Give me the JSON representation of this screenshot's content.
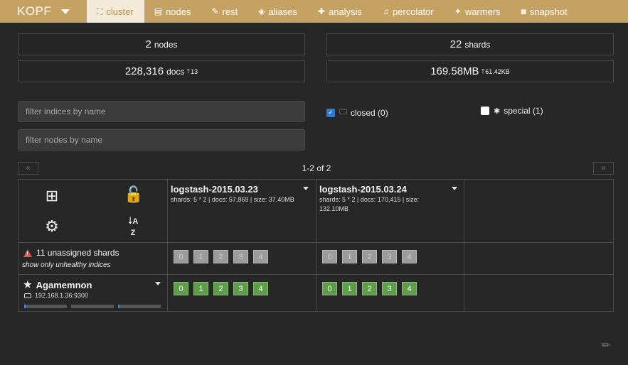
{
  "nav": {
    "brand": "KOPF",
    "items": [
      {
        "label": "cluster",
        "icon": "sitemap-icon",
        "glyph": "⛶",
        "active": true
      },
      {
        "label": "nodes",
        "icon": "server-icon",
        "glyph": "▤",
        "active": false
      },
      {
        "label": "rest",
        "icon": "edit-icon",
        "glyph": "✎",
        "active": false
      },
      {
        "label": "aliases",
        "icon": "tags-icon",
        "glyph": "◈",
        "active": false
      },
      {
        "label": "analysis",
        "icon": "puzzle-icon",
        "glyph": "✚",
        "active": false
      },
      {
        "label": "percolator",
        "icon": "bell-icon",
        "glyph": "♫",
        "active": false
      },
      {
        "label": "warmers",
        "icon": "fire-icon",
        "glyph": "✦",
        "active": false
      },
      {
        "label": "snapshot",
        "icon": "camera-icon",
        "glyph": "◙",
        "active": false
      }
    ]
  },
  "stats": {
    "nodes": {
      "value": "2",
      "label": "nodes"
    },
    "shards": {
      "value": "22",
      "label": "shards"
    },
    "docs": {
      "value": "228,316",
      "label": "docs",
      "delta": "13"
    },
    "size": {
      "value": "169.58MB",
      "delta": "61.42KB"
    }
  },
  "filters": {
    "indices_placeholder": "filter indices by name",
    "nodes_placeholder": "filter nodes by name",
    "closed": {
      "label": "closed (0)",
      "checked": true
    },
    "special": {
      "label": "special (1)",
      "checked": false
    }
  },
  "pagination": {
    "text": "1-2 of 2",
    "prev": "«",
    "next": "»"
  },
  "indices": [
    {
      "name": "logstash-2015.03.23",
      "meta1": "shards: 5 * 2 | docs: 57,869 | size: 37.40MB",
      "meta2": ""
    },
    {
      "name": "logstash-2015.03.24",
      "meta1": "shards: 5 * 2 | docs: 170,415 | size:",
      "meta2": "132.10MB"
    }
  ],
  "unassigned": {
    "text": "11 unassigned shards",
    "link": "show only unhealthy indices"
  },
  "shard_numbers": [
    "0",
    "1",
    "2",
    "3",
    "4"
  ],
  "node": {
    "name": "Agamemnon",
    "address": "192.168.1.36:9300",
    "bars": [
      0.05,
      0,
      0.03
    ]
  },
  "colors": {
    "nav_bg": "#c5a262",
    "active_tab_bg": "#f3ead9",
    "shard_ok": "#5e9d4a",
    "shard_unassigned": "#9b9b9b",
    "warning": "#d9534f"
  }
}
